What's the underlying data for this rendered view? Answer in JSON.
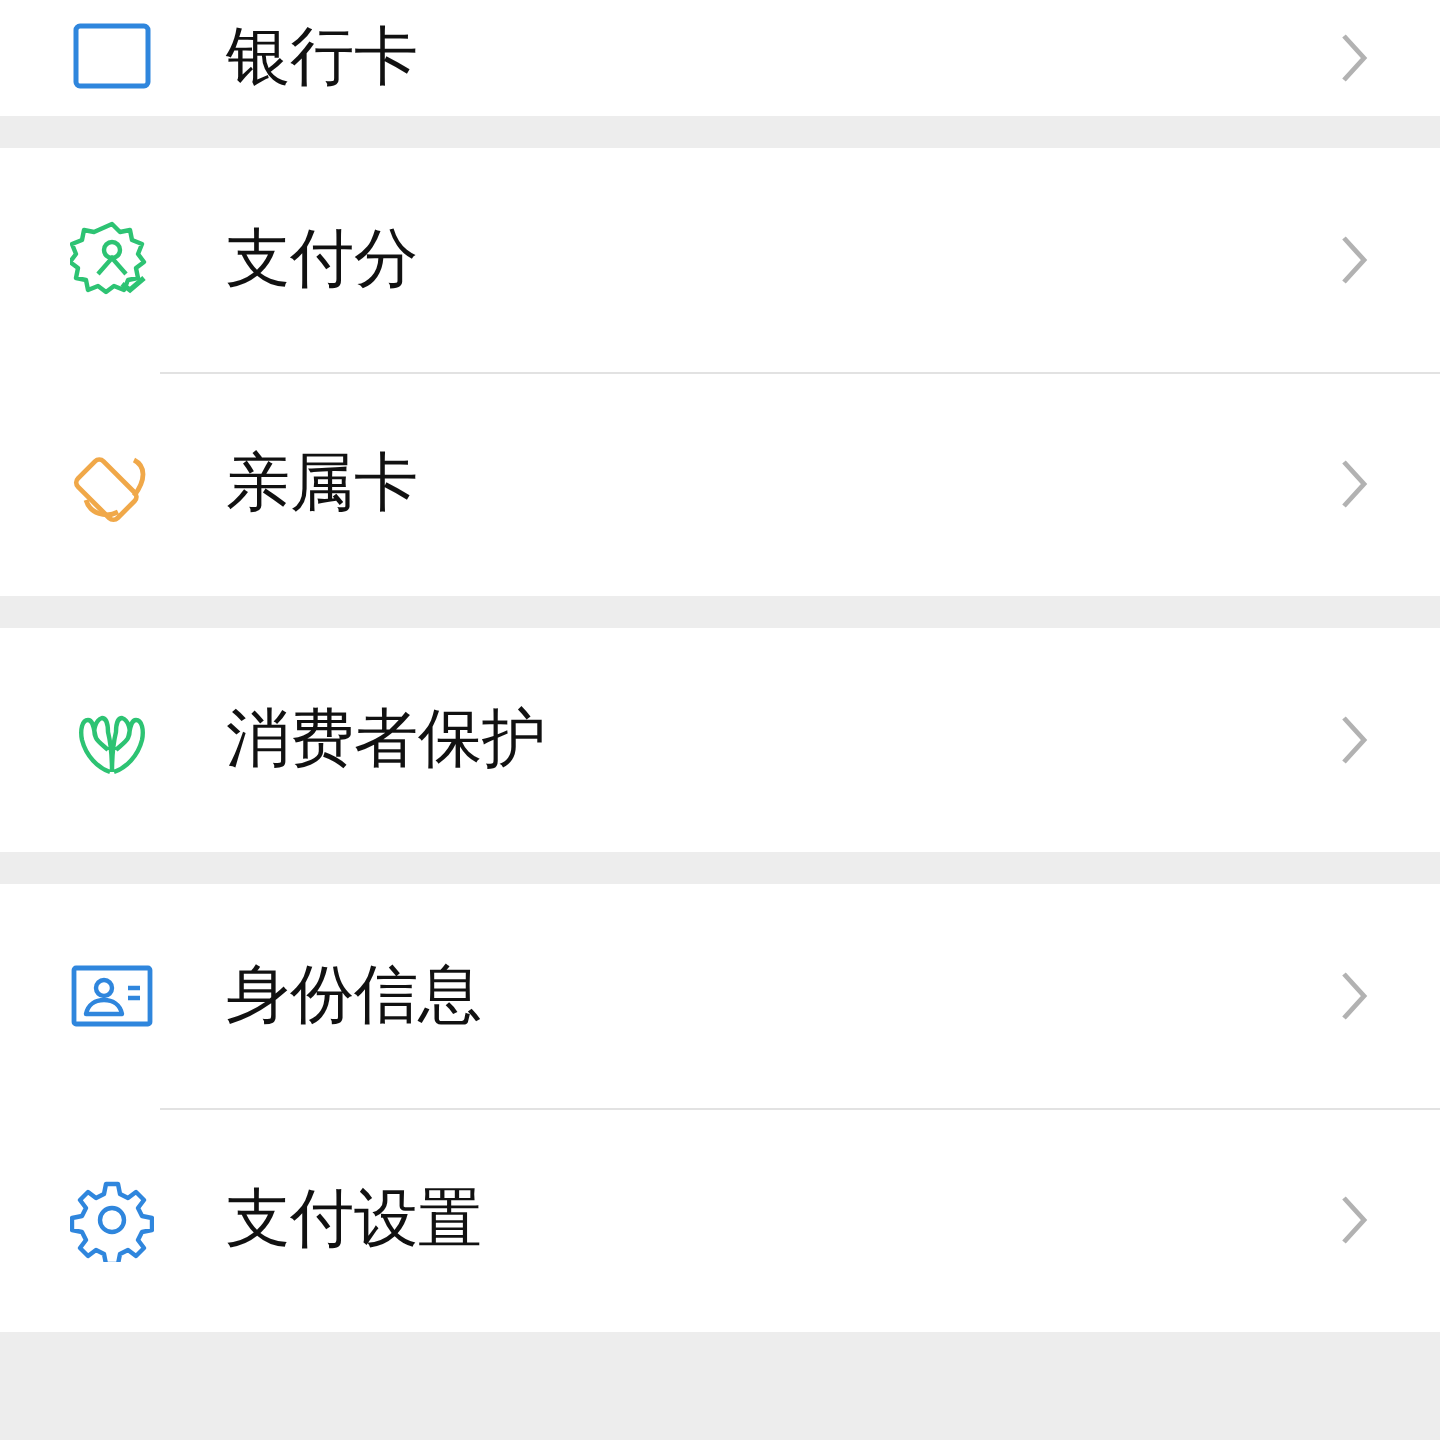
{
  "groups": [
    {
      "cut_top": true,
      "items": [
        {
          "kind": "bank-card",
          "label": "银行卡"
        }
      ]
    },
    {
      "items": [
        {
          "kind": "score",
          "label": "支付分"
        },
        {
          "kind": "family-card",
          "label": "亲属卡"
        }
      ]
    },
    {
      "items": [
        {
          "kind": "protection",
          "label": "消费者保护"
        }
      ]
    },
    {
      "items": [
        {
          "kind": "identity",
          "label": "身份信息"
        },
        {
          "kind": "settings",
          "label": "支付设置"
        }
      ]
    }
  ]
}
